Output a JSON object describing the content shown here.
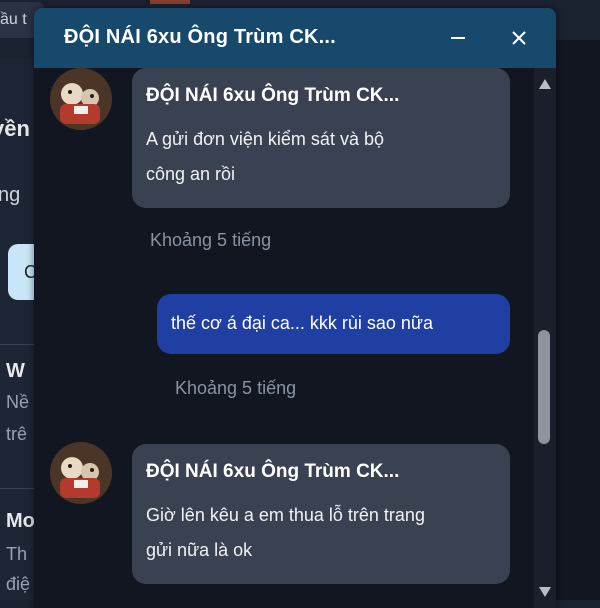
{
  "background": {
    "top_input_text": "ầu t",
    "sidebar_texts": [
      "yền",
      "ng",
      "W",
      "Nề",
      "trê",
      "Mo",
      "Th",
      "điệ"
    ],
    "pill_letter": "C"
  },
  "chat": {
    "title": "ĐỘI NÁI 6xu Ông Trùm CK...",
    "minimize_label": "—",
    "close_label": "✕",
    "messages": [
      {
        "direction": "incoming",
        "sender": "ĐỘI NÁI 6xu Ông Trùm CK...",
        "lines": [
          "A gửi đơn viện kiểm sát và bộ",
          "công an rồi"
        ],
        "time": "Khoảng 5 tiếng"
      },
      {
        "direction": "outgoing",
        "text": "thế cơ á đại ca... kkk rùi sao nữa",
        "time": "Khoảng 5 tiếng"
      },
      {
        "direction": "incoming",
        "sender": "ĐỘI NÁI 6xu Ông Trùm CK...",
        "lines": [
          "Giờ lên kêu a em thua lỗ trên trang",
          "gửi nữa là ok"
        ]
      }
    ]
  },
  "colors": {
    "header": "#17496d",
    "incoming_bubble": "#3a4252",
    "outgoing_bubble": "#1f3fa3",
    "window_bg": "#121620"
  }
}
